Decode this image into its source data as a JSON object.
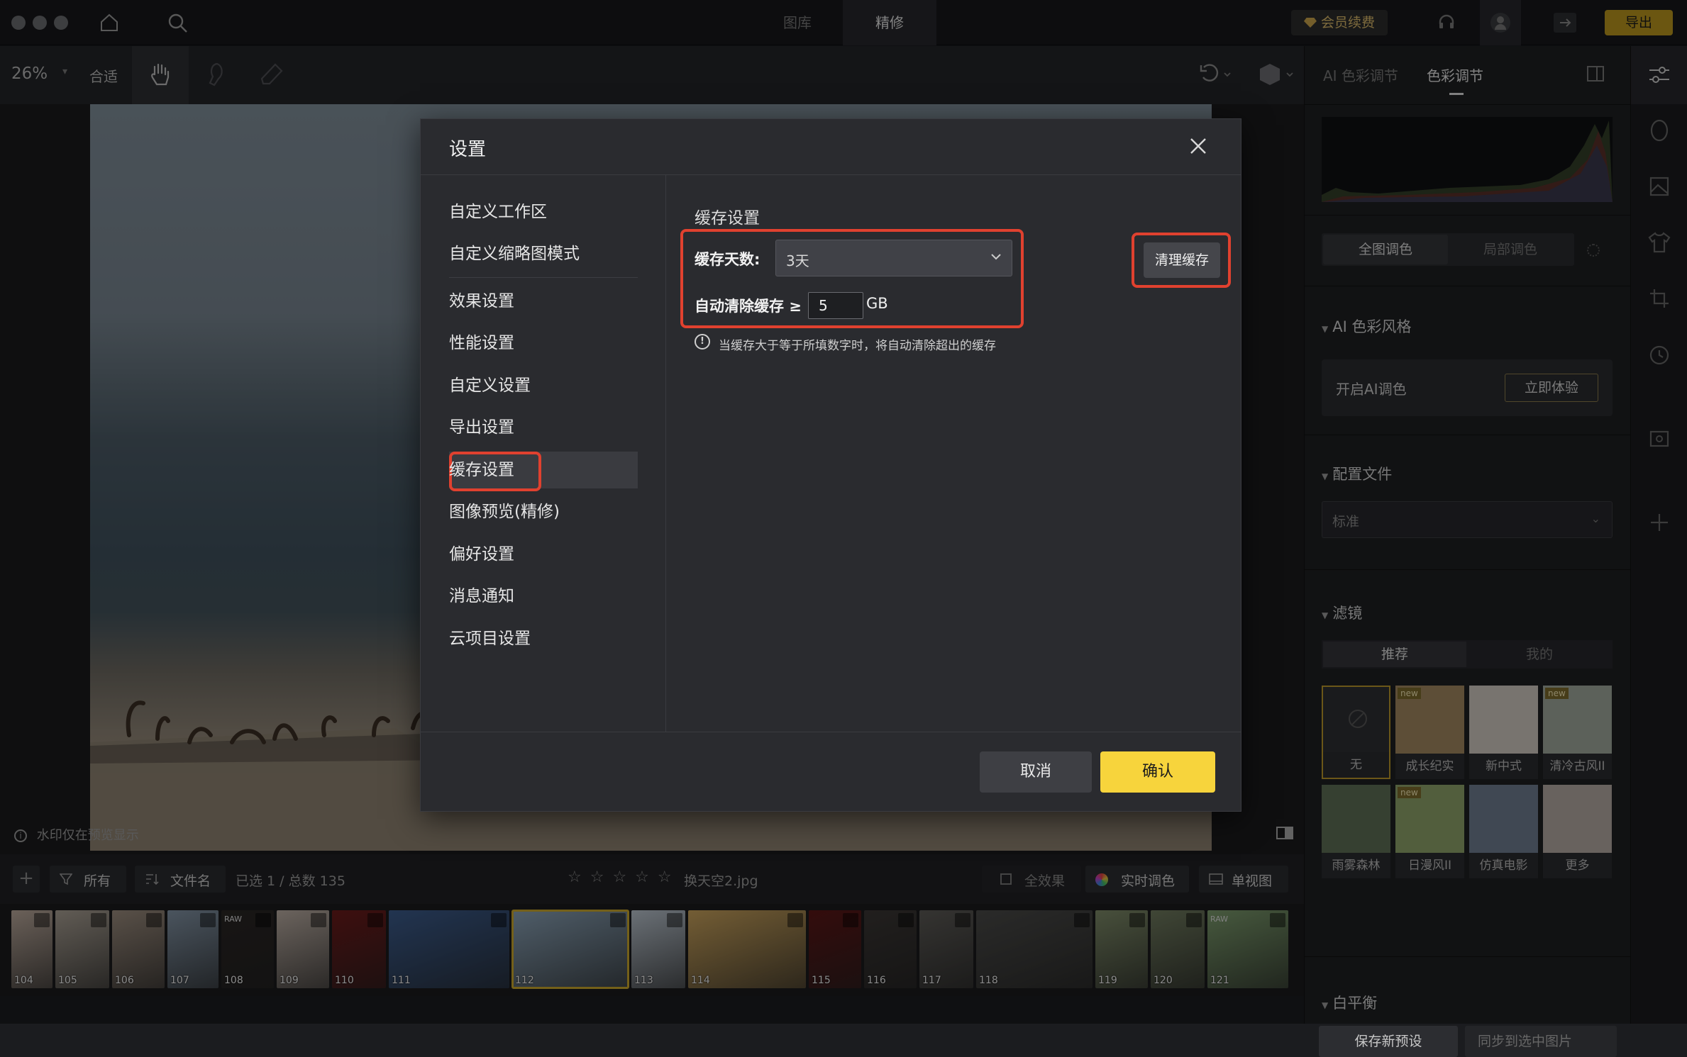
{
  "topbar": {
    "tab_library": "图库",
    "tab_retouch": "精修",
    "member": "会员续费",
    "export": "导出"
  },
  "toolbar": {
    "zoom": "26%",
    "fit": "合适"
  },
  "canvas": {
    "watermark_note": "水印仅在预览显示"
  },
  "right_panel": {
    "tab_ai": "AI 色彩调节",
    "tab_color": "色彩调节",
    "global": "全图调色",
    "local": "局部调色",
    "ai_style_title": "AI 色彩风格",
    "ai_enable": "开启AI调色",
    "ai_try": "立即体验",
    "profile_title": "配置文件",
    "profile_value": "标准",
    "filter_title": "滤镜",
    "filter_tab_rec": "推荐",
    "filter_tab_mine": "我的",
    "filters": [
      {
        "label": "无",
        "new": "",
        "color": "#2e2f33"
      },
      {
        "label": "成长纪实",
        "new": "new",
        "color": "#a08760"
      },
      {
        "label": "新中式",
        "new": "",
        "color": "#cfc9bf"
      },
      {
        "label": "清冷古风II",
        "new": "new",
        "color": "#9fa79b"
      },
      {
        "label": "雨雾森林",
        "new": "",
        "color": "#5d6e55"
      },
      {
        "label": "日漫风II",
        "new": "new",
        "color": "#8ea36a"
      },
      {
        "label": "仿真电影",
        "new": "",
        "color": "#6e7d8f"
      },
      {
        "label": "更多",
        "new": "",
        "color": "#b3a9a3"
      }
    ],
    "wb_title": "白平衡",
    "save_preset": "保存新预设",
    "sync": "同步到选中图片"
  },
  "bottombar": {
    "filter_all": "所有",
    "sort_name": "文件名",
    "selection": "已选 1 / 总数 135",
    "filename": "换天空2.jpg",
    "all_effects": "全效果",
    "realtime": "实时调色",
    "single_view": "单视图"
  },
  "thumbnails": [
    {
      "num": "104",
      "raw": "",
      "color": "#b8a79a"
    },
    {
      "num": "105",
      "raw": "",
      "color": "#a89f93"
    },
    {
      "num": "106",
      "raw": "",
      "color": "#9a8b7d"
    },
    {
      "num": "107",
      "raw": "",
      "color": "#8192a3"
    },
    {
      "num": "108",
      "raw": "RAW",
      "color": "#2a2624"
    },
    {
      "num": "109",
      "raw": "",
      "color": "#b9aca2"
    },
    {
      "num": "110",
      "raw": "",
      "color": "#6a1a1a"
    },
    {
      "num": "111",
      "raw": "",
      "color": "#3b5b8b"
    },
    {
      "num": "112",
      "raw": "",
      "color": "#8aa2b6"
    },
    {
      "num": "113",
      "raw": "",
      "color": "#b8c2cc"
    },
    {
      "num": "114",
      "raw": "",
      "color": "#c7a15c"
    },
    {
      "num": "115",
      "raw": "",
      "color": "#5a1616"
    },
    {
      "num": "116",
      "raw": "",
      "color": "#3a3634"
    },
    {
      "num": "117",
      "raw": "",
      "color": "#5c5a56"
    },
    {
      "num": "118",
      "raw": "",
      "color": "#4a4a48"
    },
    {
      "num": "119",
      "raw": "",
      "color": "#7d8a68"
    },
    {
      "num": "120",
      "raw": "",
      "color": "#6f7a5e"
    },
    {
      "num": "121",
      "raw": "RAW",
      "color": "#7b9a6c"
    }
  ],
  "dialog": {
    "title": "设置",
    "nav": [
      "自定义工作区",
      "自定义缩略图模式",
      "效果设置",
      "性能设置",
      "自定义设置",
      "导出设置",
      "缓存设置",
      "图像预览(精修)",
      "偏好设置",
      "消息通知",
      "云项目设置"
    ],
    "section_title": "缓存设置",
    "days_label": "缓存天数:",
    "days_value": "3天",
    "auto_clear_label": "自动清除缓存 ≥",
    "auto_clear_value": "5",
    "unit": "GB",
    "note": "当缓存大于等于所填数字时，将自动清除超出的缓存",
    "clear_button": "清理缓存",
    "cancel": "取消",
    "confirm": "确认"
  },
  "colors": {
    "accent": "#f7d43c",
    "highlight": "#e0412f"
  }
}
